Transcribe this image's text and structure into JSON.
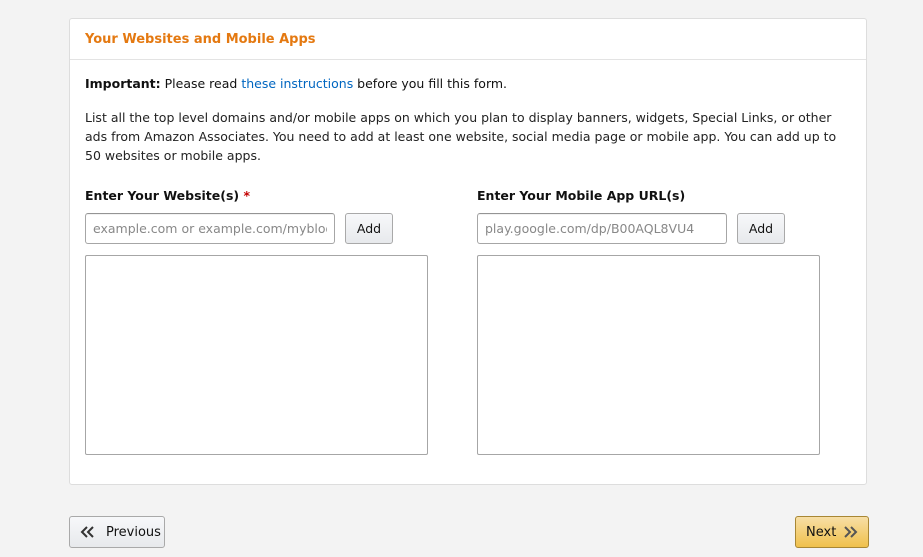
{
  "panel": {
    "title": "Your Websites and Mobile Apps"
  },
  "important": {
    "label": "Important:",
    "text_before": " Please read ",
    "link_text": "these instructions",
    "text_after": " before you fill this form."
  },
  "description": "List all the top level domains and/or mobile apps on which you plan to display banners, widgets, Special Links, or other ads from Amazon Associates. You need to add at least one website, social media page or mobile app. You can add up to 50 websites or mobile apps.",
  "websites": {
    "label": "Enter Your Website(s)",
    "required_marker": "*",
    "placeholder": "example.com or example.com/myblog",
    "value": "",
    "add_label": "Add",
    "list": []
  },
  "apps": {
    "label": "Enter Your Mobile App URL(s)",
    "placeholder": "play.google.com/dp/B00AQL8VU4",
    "value": "",
    "add_label": "Add",
    "list": []
  },
  "nav": {
    "previous_label": "Previous",
    "previous_icon": "double-chevron-left-icon",
    "next_label": "Next",
    "next_icon": "double-chevron-right-icon"
  },
  "colors": {
    "title": "#e47911",
    "link": "#0066c0",
    "required": "#c40000",
    "primary_button": "#f0c14b"
  }
}
